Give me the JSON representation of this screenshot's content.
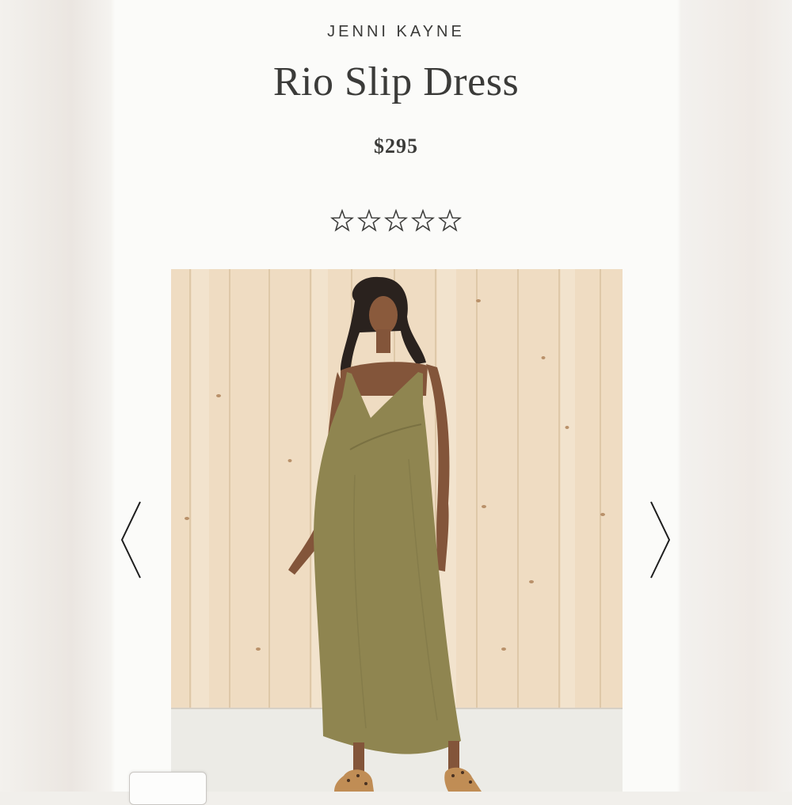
{
  "product": {
    "brand": "JENNI KAYNE",
    "name": "Rio Slip Dress",
    "price": "$295",
    "rating": 0,
    "rating_max": 5
  },
  "gallery": {
    "image_alt": "Model wearing olive Rio Slip Dress in front of light wood paneling",
    "prev_icon": "chevron-left-icon",
    "next_icon": "chevron-right-icon"
  },
  "colors": {
    "text": "#3b3b39",
    "dress": "#8f8550",
    "wood": "#efdcc2",
    "floor": "#ecebe6"
  }
}
